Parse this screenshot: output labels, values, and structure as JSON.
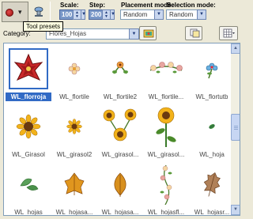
{
  "toolbar": {
    "scale_label": "Scale:",
    "scale_value": "100",
    "step_label": "Step:",
    "step_value": "200",
    "placement_label": "Placement mode:",
    "placement_value": "Random",
    "selection_label": "Selection mode:",
    "selection_value": "Random"
  },
  "tooltip": "Tool presets",
  "category": {
    "label": "Category:",
    "value": "Flores_Hojas"
  },
  "tubes": [
    {
      "label": "WL_florroja",
      "selected": true
    },
    {
      "label": "WL_flortile"
    },
    {
      "label": "WL_flortile2"
    },
    {
      "label": "WL_flortile..."
    },
    {
      "label": "WL_flortutb"
    },
    {
      "label": "WL_Girasol"
    },
    {
      "label": "WL_girasol2"
    },
    {
      "label": "WL_girasol..."
    },
    {
      "label": "WL_girasol..."
    },
    {
      "label": "WL_hoja"
    },
    {
      "label": "WL_hojas"
    },
    {
      "label": "WL_hojasa..."
    },
    {
      "label": "WL_hojasa..."
    },
    {
      "label": "WL_hojasfl..."
    },
    {
      "label": "WL_hojasr..."
    }
  ],
  "colors": {
    "accent": "#316ac5",
    "toolbar_bg": "#ece9d8",
    "tooltip_bg": "#ffffe1"
  }
}
